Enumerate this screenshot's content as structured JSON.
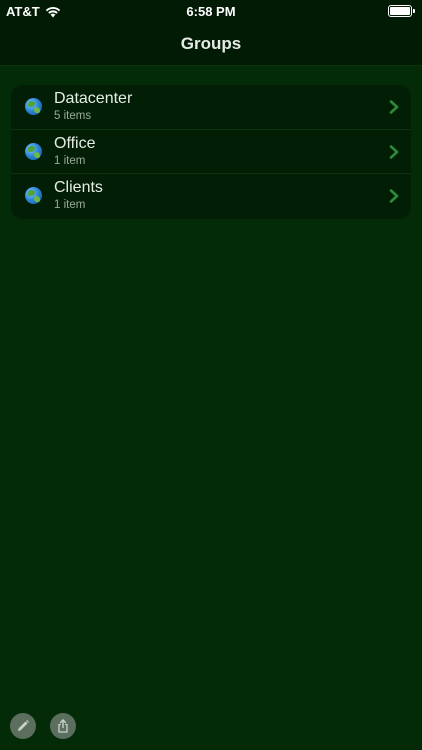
{
  "status_bar": {
    "carrier": "AT&T",
    "time": "6:58 PM",
    "battery_level": 1.0
  },
  "nav": {
    "title": "Groups"
  },
  "groups": [
    {
      "title": "Datacenter",
      "subtitle": "5 items",
      "icon": "globe-icon"
    },
    {
      "title": "Office",
      "subtitle": "1 item",
      "icon": "globe-icon"
    },
    {
      "title": "Clients",
      "subtitle": "1 item",
      "icon": "globe-icon"
    }
  ],
  "toolbar": {
    "edit_icon": "pencil-icon",
    "share_icon": "share-icon"
  },
  "colors": {
    "background": "#032b07",
    "bar": "#011b04",
    "list_background": "#021f05",
    "accent_chevron": "#2e8a3a"
  }
}
